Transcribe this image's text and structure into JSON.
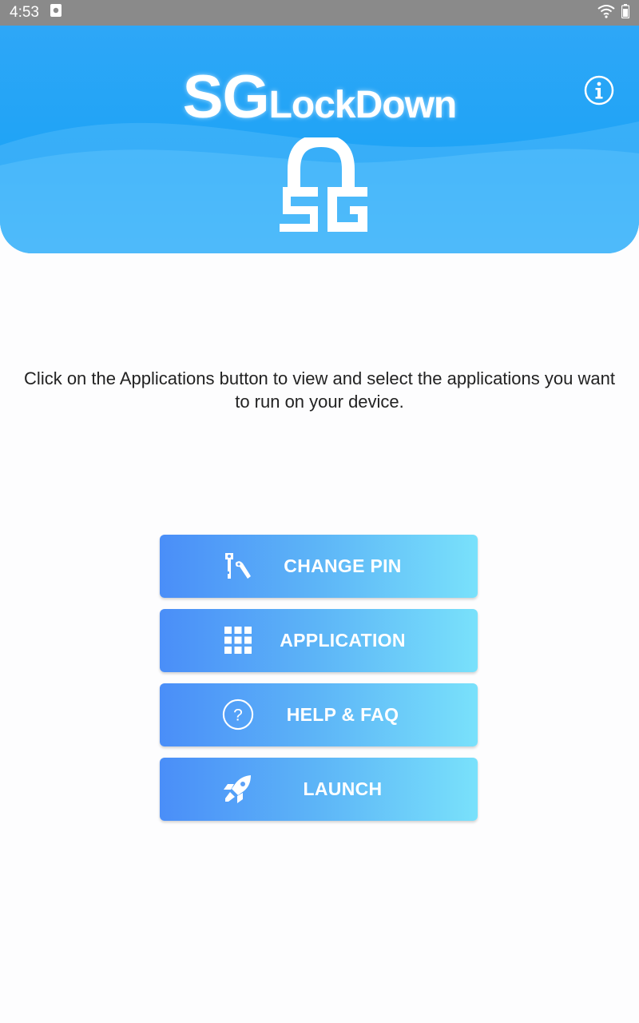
{
  "status_bar": {
    "time": "4:53",
    "icons": [
      "notification-icon",
      "wifi-icon",
      "battery-icon"
    ]
  },
  "header": {
    "logo_sg": "SG",
    "logo_lockdown": "LockDown",
    "info_icon": "info-icon"
  },
  "instruction": "Click on the Applications button to view and select the applications you want to run on your device.",
  "buttons": [
    {
      "label": "CHANGE PIN",
      "icon": "keys-icon"
    },
    {
      "label": "APPLICATION",
      "icon": "grid-icon"
    },
    {
      "label": "HELP & FAQ",
      "icon": "help-icon"
    },
    {
      "label": "LAUNCH",
      "icon": "rocket-icon"
    }
  ],
  "colors": {
    "header": "#1ea3f6",
    "button_start": "#4a8ef8",
    "button_end": "#79e1fb",
    "status_bar": "#8a8a8a"
  }
}
